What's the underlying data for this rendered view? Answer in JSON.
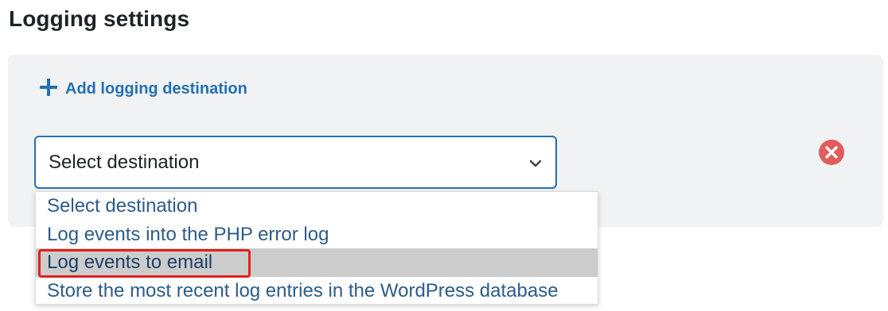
{
  "header": {
    "title": "Logging settings"
  },
  "panel": {
    "add_label": "Add logging destination"
  },
  "select": {
    "value": "Select destination",
    "options": [
      "Select destination",
      "Log events into the PHP error log",
      "Log events to email",
      "Store the most recent log entries in the WordPress database"
    ],
    "highlighted_index": 2
  },
  "colors": {
    "link": "#2271b1",
    "remove": "#e35b5b",
    "highlight_outline": "#e0211c",
    "panel_bg": "#f1f2f4"
  },
  "icons": {
    "add": "plus-icon",
    "dropdown": "chevron-down-icon",
    "remove": "close-circle-icon"
  }
}
